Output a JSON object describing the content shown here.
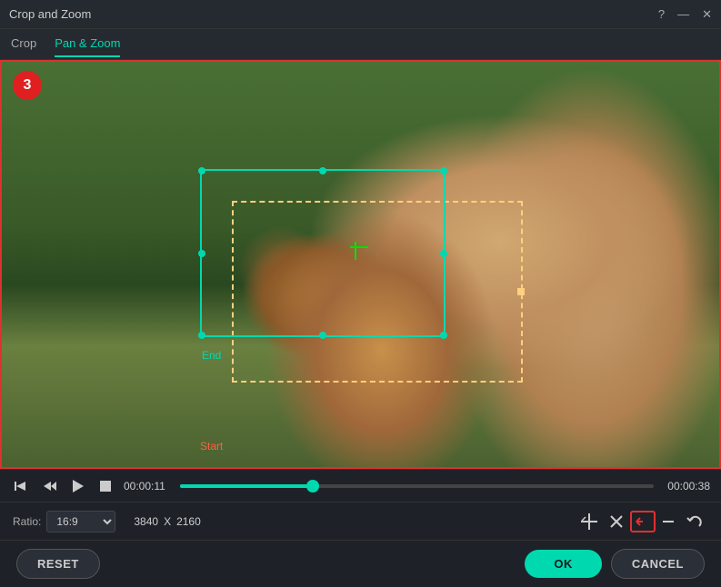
{
  "window": {
    "title": "Crop and Zoom",
    "help_icon": "?",
    "minimize_icon": "—",
    "close_icon": "✕"
  },
  "tabs": [
    {
      "id": "crop",
      "label": "Crop",
      "active": false
    },
    {
      "id": "pan-zoom",
      "label": "Pan & Zoom",
      "active": true
    }
  ],
  "video": {
    "badge_number": "3",
    "start_label": "Start",
    "end_label": "End"
  },
  "transport": {
    "current_time": "00:00:11",
    "end_time": "00:00:38",
    "progress_pct": 28
  },
  "controls": {
    "ratio_label": "Ratio:",
    "ratio_value": "16:9",
    "width": "3840",
    "x_label": "X",
    "height": "2160"
  },
  "icon_buttons": [
    {
      "id": "split",
      "symbol": "✂",
      "label": "split"
    },
    {
      "id": "aspect",
      "symbol": "✕",
      "label": "aspect"
    },
    {
      "id": "fit",
      "symbol": "⊣",
      "label": "fit-to-frame",
      "active": true
    },
    {
      "id": "dash",
      "symbol": "—",
      "label": "dash"
    },
    {
      "id": "undo",
      "symbol": "↺",
      "label": "undo"
    }
  ],
  "actions": {
    "reset_label": "RESET",
    "ok_label": "OK",
    "cancel_label": "CANCEL"
  }
}
